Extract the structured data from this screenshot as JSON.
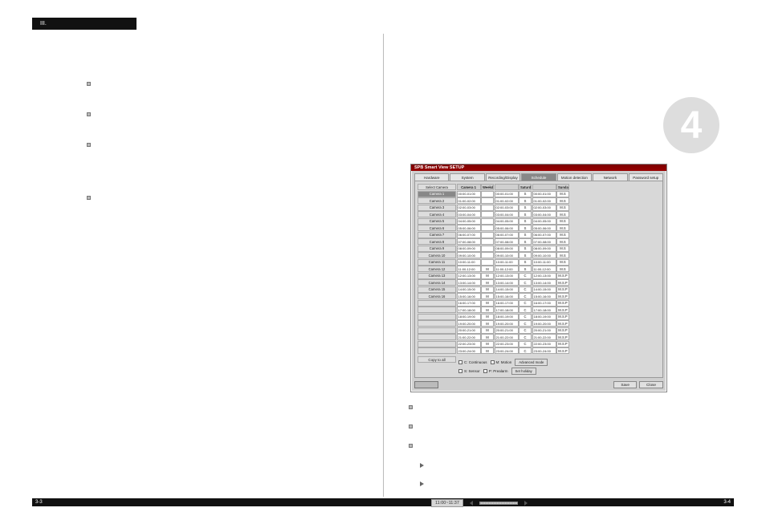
{
  "page": {
    "top_tab": "III.",
    "left_num": "3-3",
    "right_num": "3-4"
  },
  "big_number": "4",
  "left_bullets": [
    "",
    "",
    "",
    ""
  ],
  "setup": {
    "title": "SPB Smart View SETUP",
    "tabs": [
      "Hardware",
      "System",
      "Recording/Display",
      "Schedule",
      "Motion detection",
      "Network",
      "Password setup"
    ],
    "active_tab": 3,
    "select_camera_btn": "Select Camera",
    "camera_header": "Camera 1",
    "day_headers": [
      "Weekday",
      "Saturday",
      "Sunday/Holiday"
    ],
    "cameras": [
      "Camera 1",
      "Camera 2",
      "Camera 3",
      "Camera 4",
      "Camera 5",
      "Camera 6",
      "Camera 7",
      "Camera 8",
      "Camera 9",
      "Camera 10",
      "Camera 11",
      "Camera 12",
      "Camera 13",
      "Camera 14",
      "Camera 15",
      "Camera 16"
    ],
    "rows": [
      {
        "t": [
          "00:00-01:00",
          "00:00-01:00",
          "00:00-01:00"
        ],
        "c": [
          "",
          "S",
          "M.S"
        ]
      },
      {
        "t": [
          "01:00-02:00",
          "01:00-02:00",
          "01:00-02:00"
        ],
        "c": [
          "",
          "S",
          "M.S"
        ]
      },
      {
        "t": [
          "02:00-03:00",
          "02:00-03:00",
          "02:00-03:00"
        ],
        "c": [
          "",
          "S",
          "M.S"
        ]
      },
      {
        "t": [
          "03:00-04:00",
          "03:00-04:00",
          "03:00-04:00"
        ],
        "c": [
          "",
          "S",
          "M.S"
        ]
      },
      {
        "t": [
          "04:00-05:00",
          "04:00-05:00",
          "04:00-05:00"
        ],
        "c": [
          "",
          "S",
          "M.S"
        ]
      },
      {
        "t": [
          "05:00-06:00",
          "05:00-06:00",
          "05:00-06:00"
        ],
        "c": [
          "",
          "S",
          "M.S"
        ]
      },
      {
        "t": [
          "06:00-07:00",
          "06:00-07:00",
          "06:00-07:00"
        ],
        "c": [
          "",
          "S",
          "M.S"
        ]
      },
      {
        "t": [
          "07:00-08:00",
          "07:00-08:00",
          "07:00-08:00"
        ],
        "c": [
          "",
          "S",
          "M.S"
        ]
      },
      {
        "t": [
          "08:00-09:00",
          "08:00-09:00",
          "08:00-09:00"
        ],
        "c": [
          "",
          "S",
          "M.S"
        ]
      },
      {
        "t": [
          "09:00-10:00",
          "09:00-10:00",
          "09:00-10:00"
        ],
        "c": [
          "",
          "S",
          "M.S"
        ]
      },
      {
        "t": [
          "10:00-11:00",
          "10:00-11:00",
          "10:00-11:00"
        ],
        "c": [
          "",
          "S",
          "M.S"
        ]
      },
      {
        "t": [
          "11:00-12:00",
          "11:00-12:00",
          "11:00-12:00"
        ],
        "c": [
          "M",
          "S",
          "M.S"
        ]
      },
      {
        "t": [
          "12:00-13:00",
          "12:00-13:00",
          "12:00-13:00"
        ],
        "c": [
          "M",
          "C",
          "M.S.P"
        ]
      },
      {
        "t": [
          "13:00-14:00",
          "13:00-14:00",
          "13:00-14:00"
        ],
        "c": [
          "M",
          "C",
          "M.S.P"
        ]
      },
      {
        "t": [
          "14:00-15:00",
          "14:00-15:00",
          "14:00-15:00"
        ],
        "c": [
          "M",
          "C",
          "M.S.P"
        ]
      },
      {
        "t": [
          "15:00-16:00",
          "15:00-16:00",
          "15:00-16:00"
        ],
        "c": [
          "M",
          "C",
          "M.S.P"
        ]
      },
      {
        "t": [
          "16:00-17:00",
          "16:00-17:00",
          "16:00-17:00"
        ],
        "c": [
          "M",
          "C",
          "M.S.P"
        ]
      },
      {
        "t": [
          "17:00-18:00",
          "17:00-18:00",
          "17:00-18:00"
        ],
        "c": [
          "M",
          "C",
          "M.S.P"
        ]
      },
      {
        "t": [
          "18:00-19:00",
          "18:00-19:00",
          "18:00-19:00"
        ],
        "c": [
          "M",
          "C",
          "M.S.P"
        ]
      },
      {
        "t": [
          "19:00-20:00",
          "19:00-20:00",
          "19:00-20:00"
        ],
        "c": [
          "M",
          "C",
          "M.S.P"
        ]
      },
      {
        "t": [
          "20:00-21:00",
          "20:00-21:00",
          "20:00-21:00"
        ],
        "c": [
          "M",
          "C",
          "M.S.P"
        ]
      },
      {
        "t": [
          "21:00-22:00",
          "21:00-22:00",
          "21:00-22:00"
        ],
        "c": [
          "M",
          "C",
          "M.S.P"
        ]
      },
      {
        "t": [
          "22:00-23:00",
          "22:00-23:00",
          "22:00-23:00"
        ],
        "c": [
          "M",
          "C",
          "M.S.P"
        ]
      },
      {
        "t": [
          "23:00-24:00",
          "23:00-24:00",
          "23:00-24:00"
        ],
        "c": [
          "M",
          "C",
          "M.S.P"
        ]
      }
    ],
    "copy_btn": "Copy to all",
    "checks": [
      {
        "label": "C: Continuous"
      },
      {
        "label": "M: Motion"
      },
      {
        "label": "S: Sensor"
      },
      {
        "label": "P: Prealarm"
      }
    ],
    "adv_btn": "Advanced mode",
    "hol_btn": "Set holiday",
    "save_btn": "Save",
    "close_btn": "Close"
  },
  "right_bullets": [
    "",
    "",
    ""
  ],
  "right_tris": [
    "",
    ""
  ],
  "time_chip": "11:00~11:37"
}
